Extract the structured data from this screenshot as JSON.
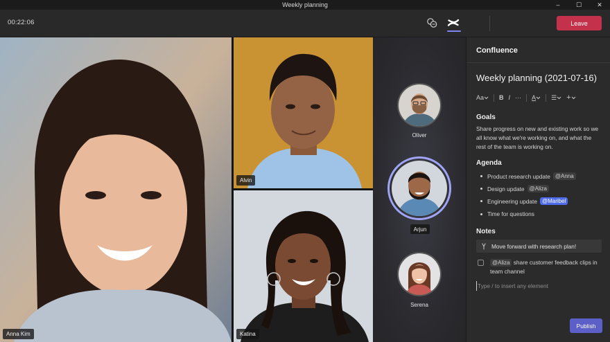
{
  "window": {
    "title": "Weekly planning",
    "controls": {
      "minimize": "–",
      "maximize": "☐",
      "close": "✕"
    }
  },
  "toolbar": {
    "timer": "00:22:06",
    "icons": [
      "apps-icon",
      "confluence-icon"
    ],
    "leave_label": "Leave",
    "leave_color": "#c4314b"
  },
  "participants": {
    "main": [
      {
        "name": "Anna Kim"
      },
      {
        "name": "Alvin"
      },
      {
        "name": "Katina"
      }
    ],
    "rail": [
      {
        "name": "Oliver"
      },
      {
        "name": "Arjun",
        "active": true
      },
      {
        "name": "Serena"
      }
    ]
  },
  "panel": {
    "app_name": "Confluence",
    "doc_title": "Weekly planning (2021-07-16)",
    "format_toolbar": {
      "text_style": "Aa",
      "bold": "B",
      "italic": "I",
      "more": "···",
      "color": "A",
      "list": "☰",
      "insert": "+"
    },
    "goals": {
      "heading": "Goals",
      "text": "Share progress on new and existing work so we all know what we're working on, and what the rest of the team is working on."
    },
    "agenda": {
      "heading": "Agenda",
      "items": [
        {
          "text": "Product research update",
          "mention": "@Anna",
          "highlight": false
        },
        {
          "text": "Design update",
          "mention": "@Aliza",
          "highlight": false
        },
        {
          "text": "Engineering update",
          "mention": "@Maribel",
          "highlight": true
        },
        {
          "text": "Time for questions",
          "mention": "",
          "highlight": false
        }
      ]
    },
    "notes": {
      "heading": "Notes",
      "decision": "Move forward with research plan!",
      "task_mention": "@Aliza",
      "task_text": "share customer feedback clips in team channel",
      "input_placeholder": "Type / to insert any element"
    },
    "publish_label": "Publish",
    "accent_color": "#5b5fc7"
  }
}
